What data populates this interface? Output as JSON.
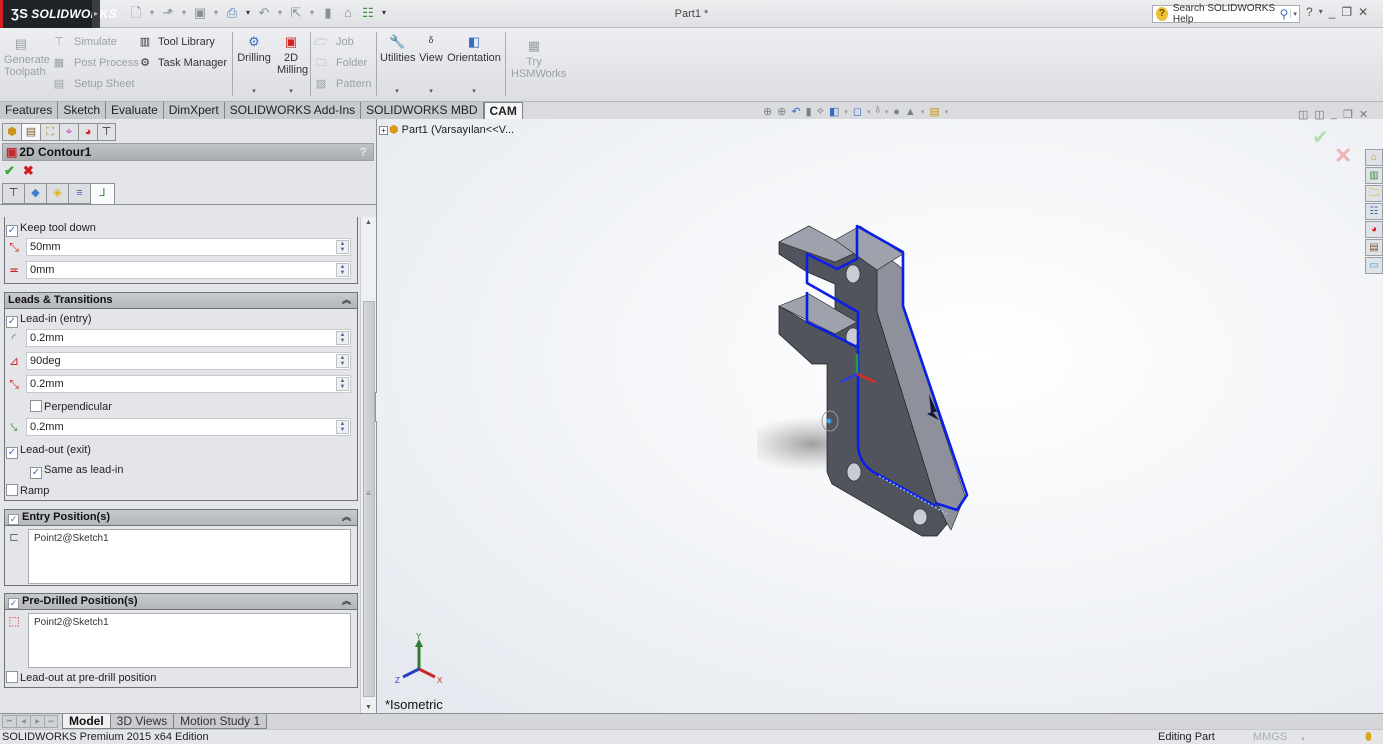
{
  "app": {
    "logo": "SOLIDWORKS",
    "document_title": "Part1 *",
    "help_search_placeholder": "Search SOLIDWORKS Help"
  },
  "quick_access": [
    {
      "name": "new-document-icon",
      "glyph": "🗋"
    },
    {
      "name": "open-icon",
      "glyph": "📂"
    },
    {
      "name": "save-icon",
      "glyph": "💾"
    },
    {
      "name": "print-icon",
      "glyph": "🖶"
    },
    {
      "name": "undo-icon",
      "glyph": "↶"
    },
    {
      "name": "select-icon",
      "glyph": "⇱"
    },
    {
      "name": "rebuild-icon",
      "glyph": "▮"
    },
    {
      "name": "file-properties-icon",
      "glyph": "⌂"
    },
    {
      "name": "options-icon",
      "glyph": "☷"
    }
  ],
  "ribbon": {
    "generate_toolpath": "Generate Toolpath",
    "simulate": "Simulate",
    "post_process": "Post Process",
    "setup_sheet": "Setup Sheet",
    "tool_library": "Tool Library",
    "task_manager": "Task Manager",
    "drilling": "Drilling",
    "milling_2d": "2D Milling",
    "job": "Job",
    "folder": "Folder",
    "pattern": "Pattern",
    "utilities": "Utilities",
    "view": "View",
    "orientation": "Orientation",
    "try_hsmworks": "Try HSMWorks"
  },
  "command_tabs": [
    {
      "label": "Features",
      "active": false
    },
    {
      "label": "Sketch",
      "active": false
    },
    {
      "label": "Evaluate",
      "active": false
    },
    {
      "label": "DimXpert",
      "active": false
    },
    {
      "label": "SOLIDWORKS Add-Ins",
      "active": false
    },
    {
      "label": "SOLIDWORKS MBD",
      "active": false
    },
    {
      "label": "CAM",
      "active": true
    }
  ],
  "property_manager": {
    "title": "2D Contour1",
    "help": "?",
    "keep_tool_down": {
      "label": "Keep tool down",
      "checked": true,
      "distance": "50mm",
      "offset": "0mm"
    },
    "leads_transitions": {
      "title": "Leads & Transitions",
      "lead_in": {
        "label": "Lead-in (entry)",
        "checked": true
      },
      "lead_in_radius": "0.2mm",
      "sweep_angle": "90deg",
      "linear_distance": "0.2mm",
      "perpendicular": {
        "label": "Perpendicular",
        "checked": false
      },
      "vertical_distance": "0.2mm",
      "lead_out": {
        "label": "Lead-out (exit)",
        "checked": true
      },
      "same_as_lead_in": {
        "label": "Same as lead-in",
        "checked": true
      },
      "ramp": {
        "label": "Ramp",
        "checked": false
      }
    },
    "entry_positions": {
      "title": "Entry Position(s)",
      "checked": true,
      "items": [
        "Point2@Sketch1"
      ]
    },
    "predrilled_positions": {
      "title": "Pre-Drilled Position(s)",
      "checked": true,
      "items": [
        "Point2@Sketch1"
      ],
      "lead_out_at_predrill": {
        "label": "Lead-out at pre-drill position",
        "checked": false
      }
    }
  },
  "viewport": {
    "tree_root": "Part1  (Varsayılan<<V...",
    "view_name": "*Isometric",
    "triad_labels": {
      "x": "X",
      "y": "Y",
      "z": "Z"
    }
  },
  "bottom_tabs": [
    {
      "label": "Model",
      "active": true
    },
    {
      "label": "3D Views",
      "active": false
    },
    {
      "label": "Motion Study 1",
      "active": false
    }
  ],
  "status": {
    "edition": "SOLIDWORKS Premium 2015 x64 Edition",
    "mode": "Editing Part",
    "units": "MMGS"
  },
  "colors": {
    "toolpath": "#0a1fe6",
    "part_face": "#4f5159",
    "accept": "#3fa53a",
    "cancel": "#d01e1e"
  }
}
